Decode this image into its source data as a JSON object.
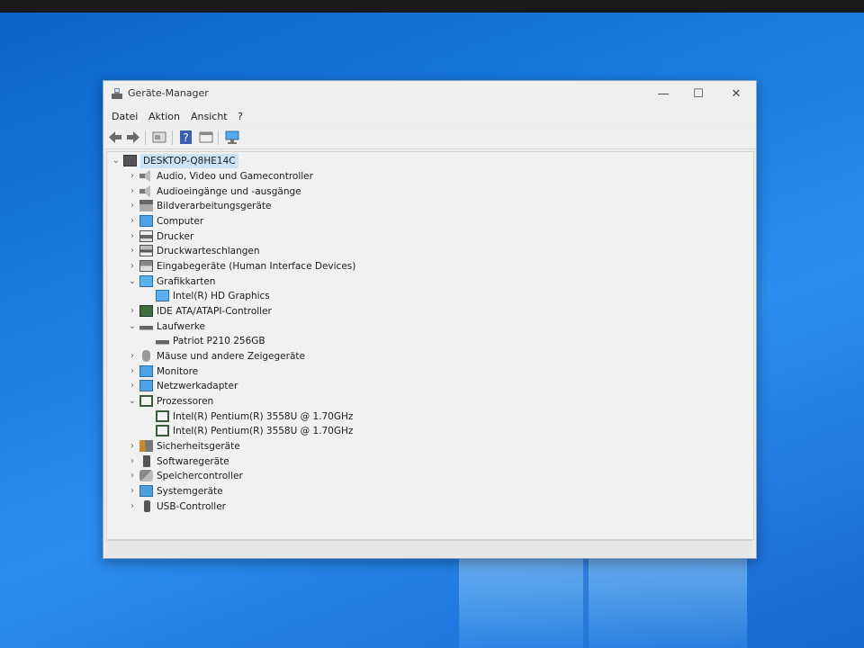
{
  "window": {
    "title": "Geräte-Manager",
    "controls": {
      "minimize": "—",
      "maximize": "☐",
      "close": "✕"
    }
  },
  "menu": [
    "Datei",
    "Aktion",
    "Ansicht",
    "?"
  ],
  "toolbar": {
    "icons": [
      "back-icon",
      "forward-icon",
      "properties-icon",
      "help-icon",
      "view-icon",
      "monitor-scan-icon"
    ]
  },
  "tree": {
    "root": "DESKTOP-Q8HE14C",
    "items": [
      {
        "label": "Audio, Video und Gamecontroller",
        "expanded": false,
        "icon": "audio-icon"
      },
      {
        "label": "Audioeingänge und -ausgänge",
        "expanded": false,
        "icon": "speaker-icon"
      },
      {
        "label": "Bildverarbeitungsgeräte",
        "expanded": false,
        "icon": "camera-icon"
      },
      {
        "label": "Computer",
        "expanded": false,
        "icon": "computer-icon"
      },
      {
        "label": "Drucker",
        "expanded": false,
        "icon": "printer-icon"
      },
      {
        "label": "Druckwarteschlangen",
        "expanded": false,
        "icon": "print-queue-icon"
      },
      {
        "label": "Eingabegeräte (Human Interface Devices)",
        "expanded": false,
        "icon": "input-device-icon"
      },
      {
        "label": "Grafikkarten",
        "expanded": true,
        "icon": "display-adapter-icon",
        "children": [
          "Intel(R) HD Graphics"
        ]
      },
      {
        "label": "IDE ATA/ATAPI-Controller",
        "expanded": false,
        "icon": "ide-controller-icon"
      },
      {
        "label": "Laufwerke",
        "expanded": true,
        "icon": "disk-drive-icon",
        "children": [
          "Patriot P210 256GB"
        ]
      },
      {
        "label": "Mäuse und andere Zeigegeräte",
        "expanded": false,
        "icon": "mouse-icon"
      },
      {
        "label": "Monitore",
        "expanded": false,
        "icon": "monitor-icon"
      },
      {
        "label": "Netzwerkadapter",
        "expanded": false,
        "icon": "network-adapter-icon"
      },
      {
        "label": "Prozessoren",
        "expanded": true,
        "icon": "processor-icon",
        "children": [
          "Intel(R) Pentium(R) 3558U @ 1.70GHz",
          "Intel(R) Pentium(R) 3558U @ 1.70GHz"
        ]
      },
      {
        "label": "Sicherheitsgeräte",
        "expanded": false,
        "icon": "security-device-icon"
      },
      {
        "label": "Softwaregeräte",
        "expanded": false,
        "icon": "software-device-icon"
      },
      {
        "label": "Speichercontroller",
        "expanded": false,
        "icon": "storage-controller-icon"
      },
      {
        "label": "Systemgeräte",
        "expanded": false,
        "icon": "system-device-icon"
      },
      {
        "label": "USB-Controller",
        "expanded": false,
        "icon": "usb-icon"
      }
    ]
  }
}
